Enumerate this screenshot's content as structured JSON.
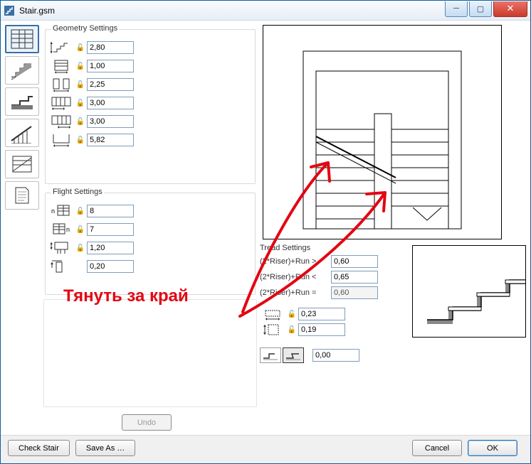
{
  "window": {
    "title": "Stair.gsm"
  },
  "leftnav": {
    "items": [
      {
        "name": "nav-geometry"
      },
      {
        "name": "nav-structure"
      },
      {
        "name": "nav-treadriser"
      },
      {
        "name": "nav-railing"
      },
      {
        "name": "nav-2dsymbol"
      },
      {
        "name": "nav-listing"
      }
    ],
    "selected": 0
  },
  "geometry": {
    "title": "Geometry Settings",
    "rows": [
      {
        "value": "2,80",
        "icon": "stair-total-height"
      },
      {
        "value": "1,00",
        "icon": "flight-width"
      },
      {
        "value": "2,25",
        "icon": "well-width"
      },
      {
        "value": "3,00",
        "icon": "lower-landing-length"
      },
      {
        "value": "3,00",
        "icon": "upper-landing-length"
      },
      {
        "value": "5,82",
        "icon": "total-run-length"
      }
    ]
  },
  "flight": {
    "title": "Flight Settings",
    "rows": [
      {
        "value": "8",
        "icon": "num-risers-1"
      },
      {
        "value": "7",
        "icon": "num-risers-2"
      },
      {
        "value": "1,20",
        "icon": "landing-depth"
      },
      {
        "value": "0,20",
        "icon": "offset",
        "nolock": true
      }
    ]
  },
  "tread": {
    "title": "Tread Settings",
    "formula": {
      "gt": {
        "label": "(2*Riser)+Run >",
        "value": "0,60"
      },
      "lt": {
        "label": "(2*Riser)+Run <",
        "value": "0,65"
      },
      "eq": {
        "label": "(2*Riser)+Run =",
        "value": "0,60"
      }
    },
    "dims": [
      {
        "value": "0,23",
        "icon": "going"
      },
      {
        "value": "0,19",
        "icon": "riser"
      }
    ],
    "nosing": {
      "value": "0,00"
    }
  },
  "buttons": {
    "undo": "Undo",
    "check": "Check Stair",
    "saveas": "Save As …",
    "cancel": "Cancel",
    "ok": "OK"
  },
  "annotation": {
    "text": "Тянуть за край"
  }
}
